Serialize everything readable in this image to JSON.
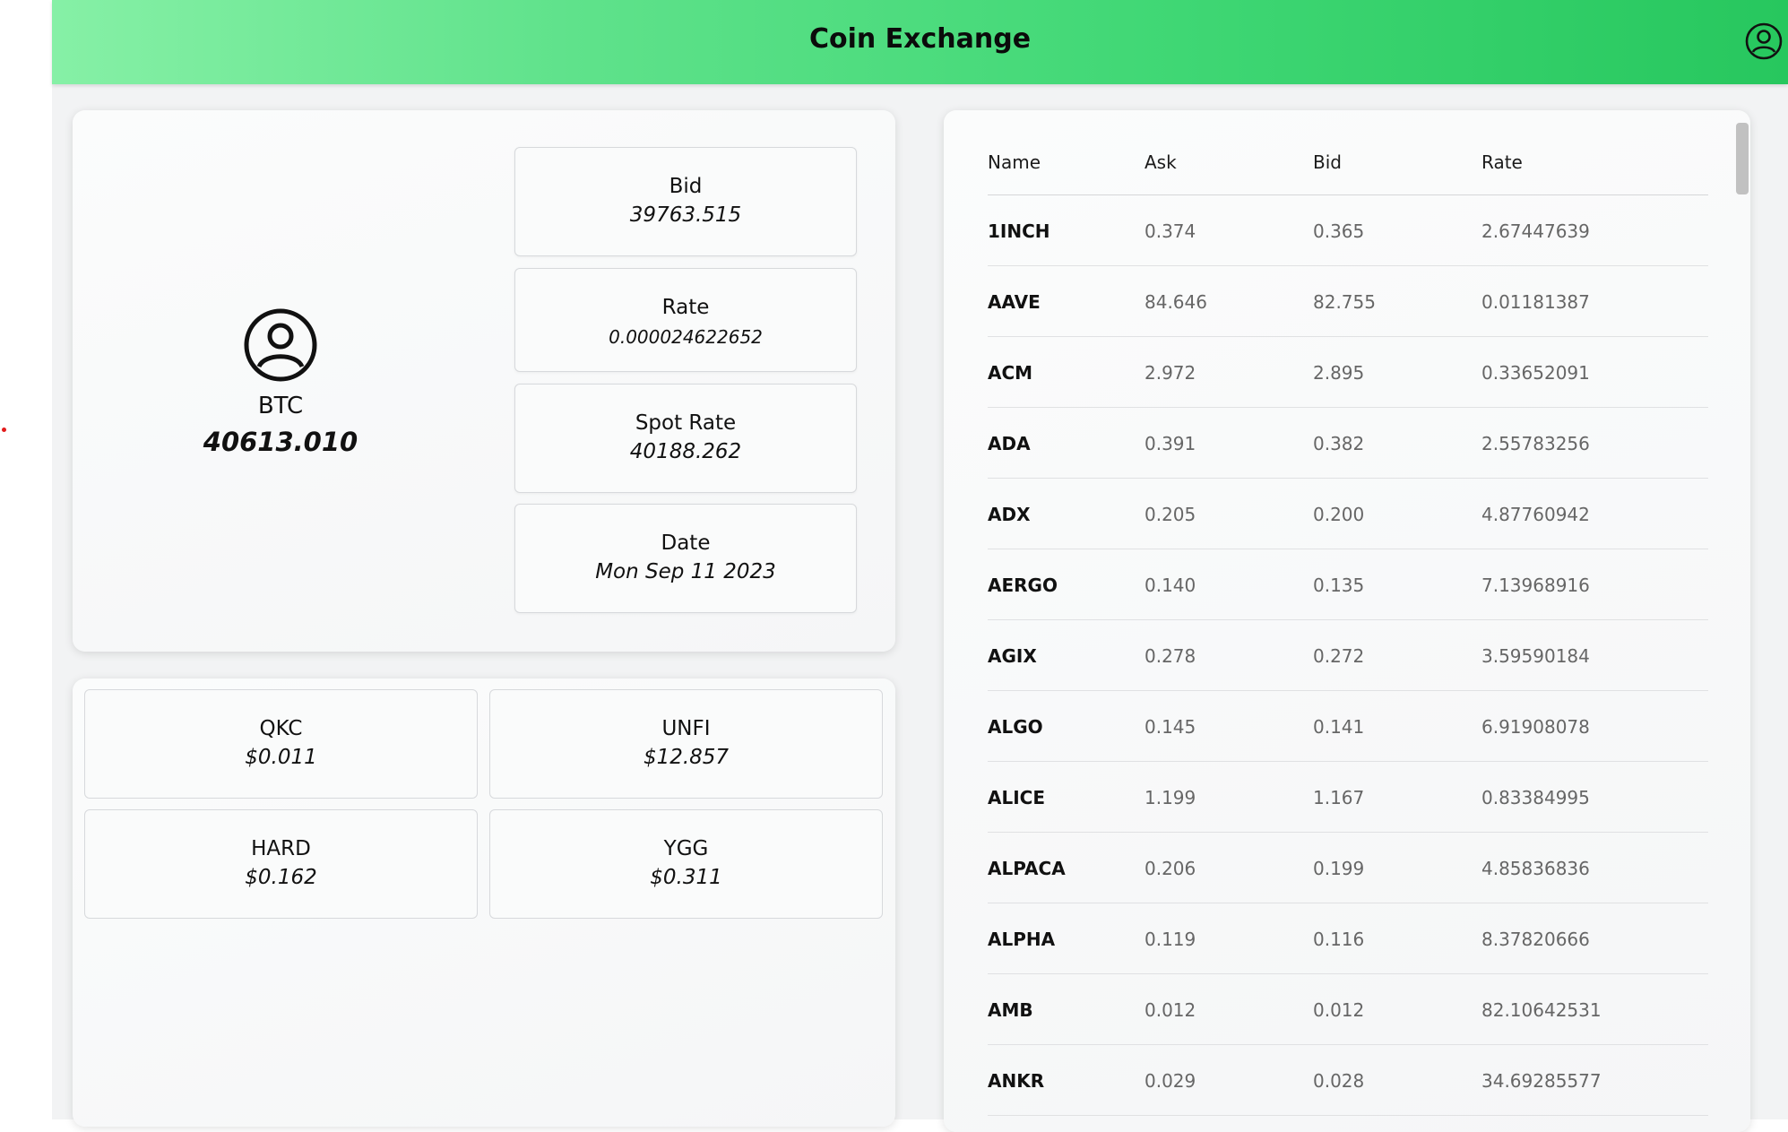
{
  "app": {
    "title": "Coin Exchange"
  },
  "coin": {
    "symbol": "BTC",
    "price": "40613.010",
    "bid_label": "Bid",
    "bid_value": "39763.515",
    "rate_label": "Rate",
    "rate_value": "0.000024622652",
    "spot_label": "Spot Rate",
    "spot_value": "40188.262",
    "date_label": "Date",
    "date_value": "Mon Sep 11 2023"
  },
  "mini_coins": [
    {
      "name": "QKC",
      "price": "$0.011"
    },
    {
      "name": "UNFI",
      "price": "$12.857"
    },
    {
      "name": "HARD",
      "price": "$0.162"
    },
    {
      "name": "YGG",
      "price": "$0.311"
    }
  ],
  "table": {
    "headers": {
      "name": "Name",
      "ask": "Ask",
      "bid": "Bid",
      "rate": "Rate"
    },
    "rows": [
      {
        "name": "1INCH",
        "ask": "0.374",
        "bid": "0.365",
        "rate": "2.67447639"
      },
      {
        "name": "AAVE",
        "ask": "84.646",
        "bid": "82.755",
        "rate": "0.01181387"
      },
      {
        "name": "ACM",
        "ask": "2.972",
        "bid": "2.895",
        "rate": "0.33652091"
      },
      {
        "name": "ADA",
        "ask": "0.391",
        "bid": "0.382",
        "rate": "2.55783256"
      },
      {
        "name": "ADX",
        "ask": "0.205",
        "bid": "0.200",
        "rate": "4.87760942"
      },
      {
        "name": "AERGO",
        "ask": "0.140",
        "bid": "0.135",
        "rate": "7.13968916"
      },
      {
        "name": "AGIX",
        "ask": "0.278",
        "bid": "0.272",
        "rate": "3.59590184"
      },
      {
        "name": "ALGO",
        "ask": "0.145",
        "bid": "0.141",
        "rate": "6.91908078"
      },
      {
        "name": "ALICE",
        "ask": "1.199",
        "bid": "1.167",
        "rate": "0.83384995"
      },
      {
        "name": "ALPACA",
        "ask": "0.206",
        "bid": "0.199",
        "rate": "4.85836836"
      },
      {
        "name": "ALPHA",
        "ask": "0.119",
        "bid": "0.116",
        "rate": "8.37820666"
      },
      {
        "name": "AMB",
        "ask": "0.012",
        "bid": "0.012",
        "rate": "82.10642531"
      },
      {
        "name": "ANKR",
        "ask": "0.029",
        "bid": "0.028",
        "rate": "34.69285577"
      }
    ]
  },
  "icons": {
    "header_user": "user-circle-icon",
    "coin_avatar": "user-circle-icon"
  },
  "colors": {
    "header_start": "#86f0a6",
    "header_end": "#27c75e",
    "accent_dot": "#e21b1b"
  }
}
